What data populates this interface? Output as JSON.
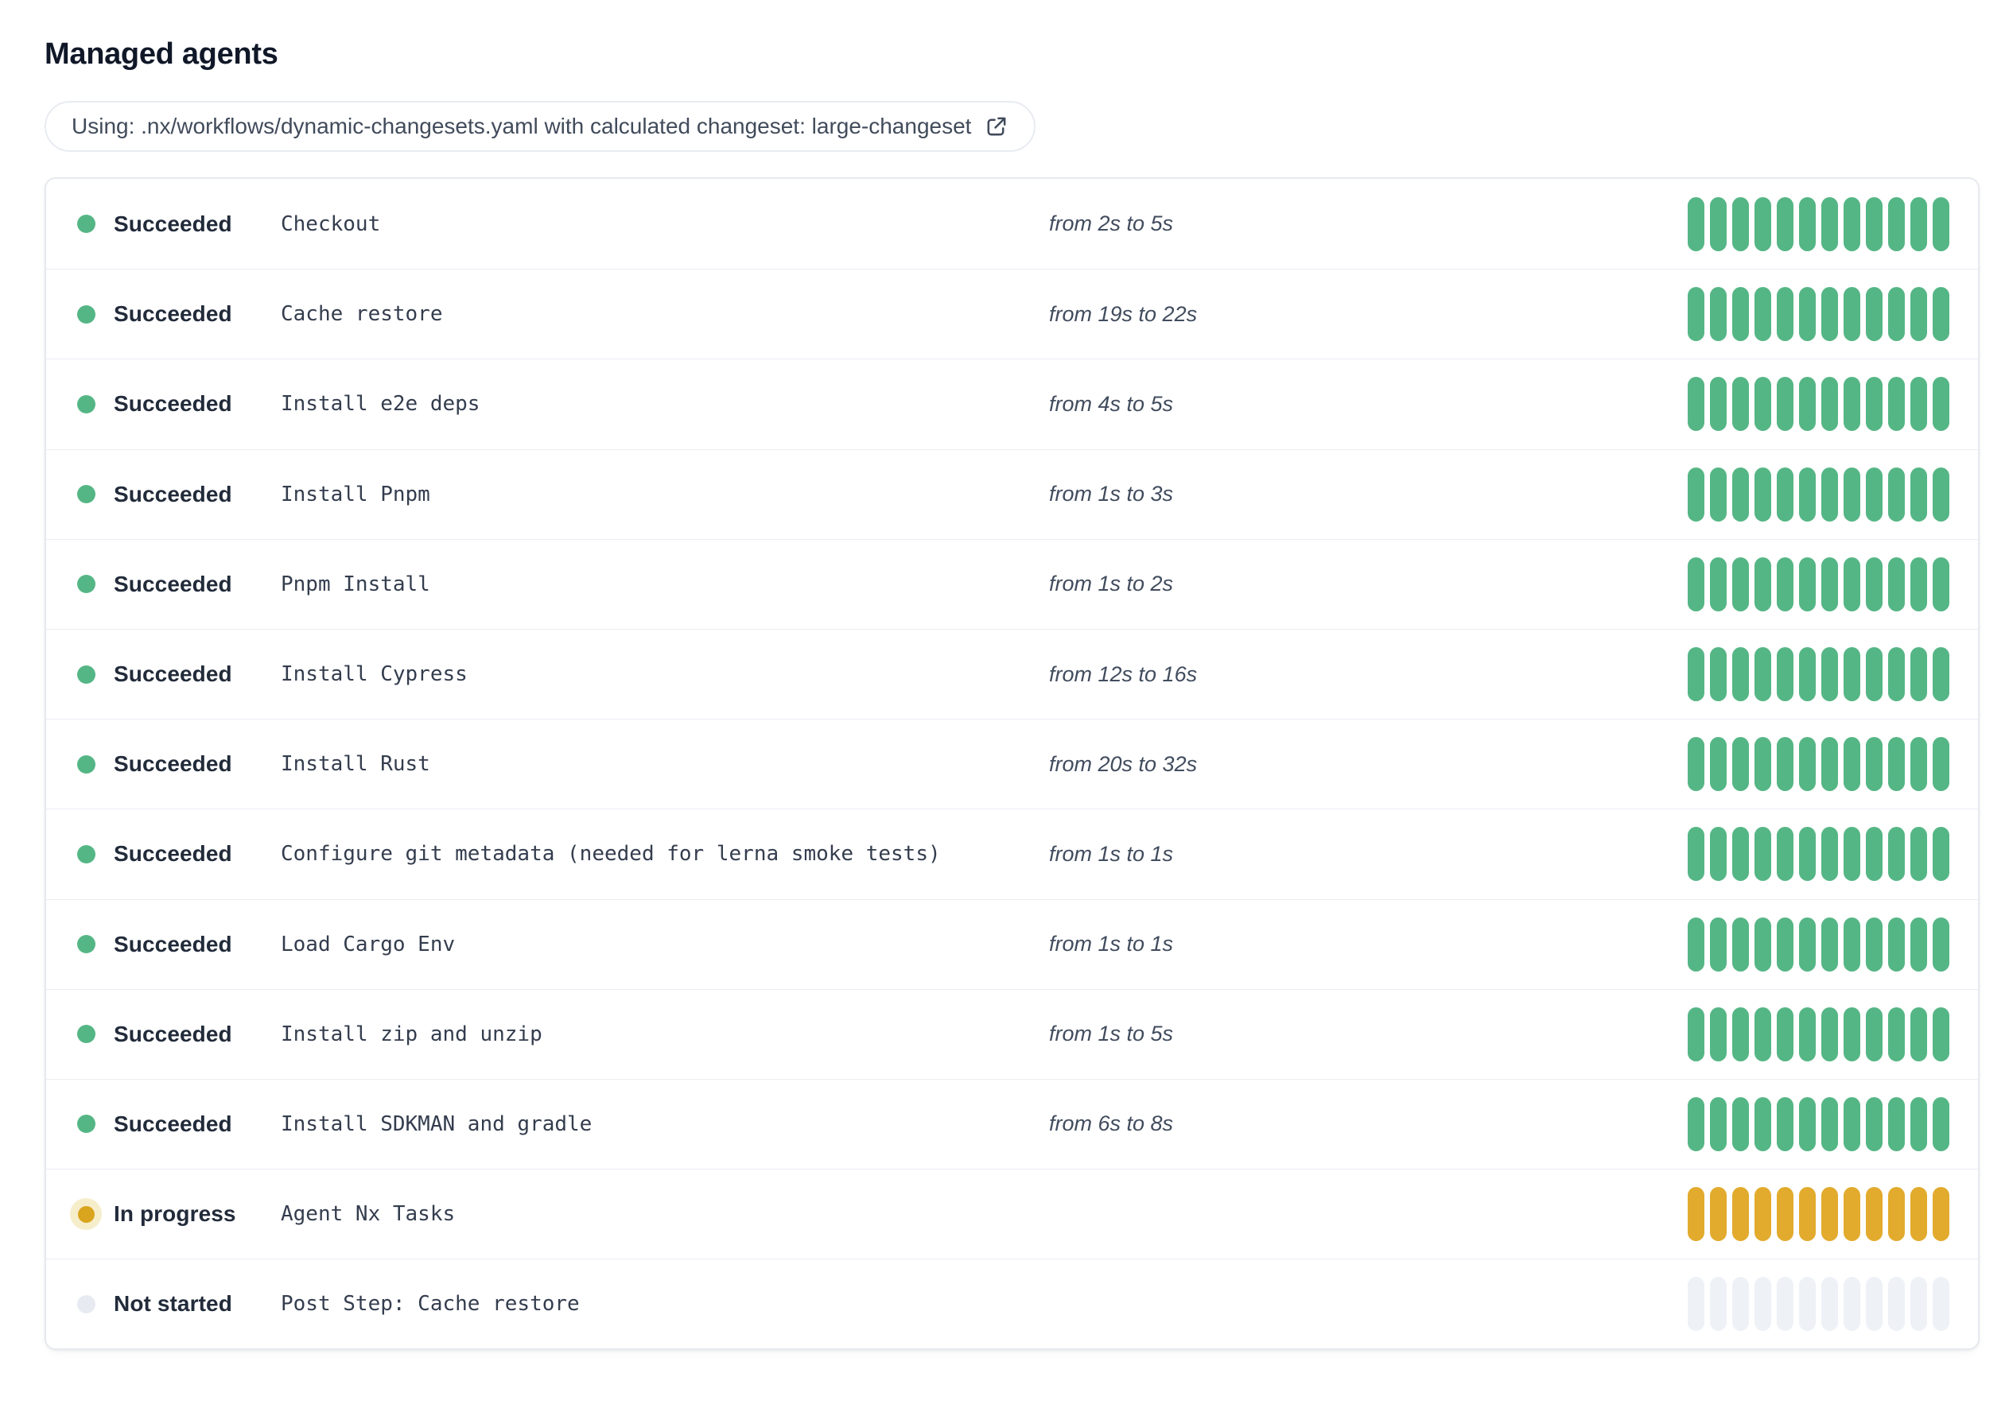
{
  "page": {
    "title": "Managed agents"
  },
  "banner": {
    "label": "Using: .nx/workflows/dynamic-changesets.yaml with calculated changeset: large-changeset",
    "icon": "external-link-icon"
  },
  "bar": {
    "segments_per_bar": 12
  },
  "colors": {
    "succeeded": "#55b685",
    "in_progress": "#e2ab2d",
    "in_progress_dot": "#d9a41e",
    "in_progress_halo": "#f6edcb",
    "not_started_segment": "#eef1f6",
    "not_started_dot": "#e7ebf1"
  },
  "agents": [
    {
      "status": "Succeeded",
      "status_key": "succeeded",
      "step": "Checkout",
      "duration": "from 2s to 5s"
    },
    {
      "status": "Succeeded",
      "status_key": "succeeded",
      "step": "Cache restore",
      "duration": "from 19s to 22s"
    },
    {
      "status": "Succeeded",
      "status_key": "succeeded",
      "step": "Install e2e deps",
      "duration": "from 4s to 5s"
    },
    {
      "status": "Succeeded",
      "status_key": "succeeded",
      "step": "Install Pnpm",
      "duration": "from 1s to 3s"
    },
    {
      "status": "Succeeded",
      "status_key": "succeeded",
      "step": "Pnpm Install",
      "duration": "from 1s to 2s"
    },
    {
      "status": "Succeeded",
      "status_key": "succeeded",
      "step": "Install Cypress",
      "duration": "from 12s to 16s"
    },
    {
      "status": "Succeeded",
      "status_key": "succeeded",
      "step": "Install Rust",
      "duration": "from 20s to 32s"
    },
    {
      "status": "Succeeded",
      "status_key": "succeeded",
      "step": "Configure git metadata (needed for lerna smoke tests)",
      "duration": "from 1s to 1s"
    },
    {
      "status": "Succeeded",
      "status_key": "succeeded",
      "step": "Load Cargo Env",
      "duration": "from 1s to 1s"
    },
    {
      "status": "Succeeded",
      "status_key": "succeeded",
      "step": "Install zip and unzip",
      "duration": "from 1s to 5s"
    },
    {
      "status": "Succeeded",
      "status_key": "succeeded",
      "step": "Install SDKMAN and gradle",
      "duration": "from 6s to 8s"
    },
    {
      "status": "In progress",
      "status_key": "in-progress",
      "step": "Agent Nx Tasks",
      "duration": ""
    },
    {
      "status": "Not started",
      "status_key": "not-started",
      "step": "Post Step: Cache restore",
      "duration": ""
    }
  ]
}
